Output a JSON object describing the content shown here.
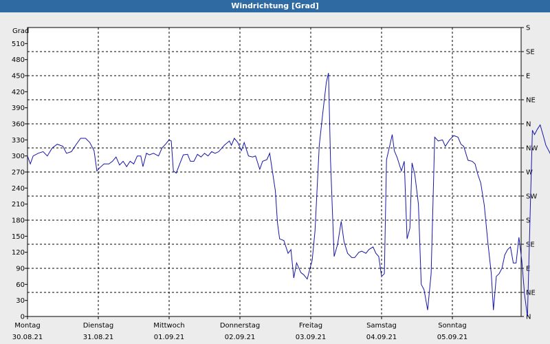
{
  "window": {
    "title": "Windrichtung [Grad]"
  },
  "colors": {
    "line": "#1515a8",
    "grid": "#000000",
    "titlebar": "#2f6aa3",
    "background": "#ececec",
    "plot": "#ffffff"
  },
  "chart_data": {
    "type": "line",
    "title": "Windrichtung [Grad]",
    "ylabel": "Grad",
    "ylim": [
      0,
      540
    ],
    "grid": true,
    "y_ticks": [
      0,
      30,
      60,
      90,
      120,
      150,
      180,
      210,
      240,
      270,
      300,
      330,
      360,
      390,
      420,
      450,
      480,
      510
    ],
    "right_axis_labels": [
      "N",
      "NE",
      "E",
      "SE",
      "S",
      "SW",
      "W",
      "NW",
      "N",
      "NE",
      "E",
      "SE",
      "S"
    ],
    "x_days": [
      {
        "day": "Montag",
        "date": "30.08.21"
      },
      {
        "day": "Dienstag",
        "date": "31.08.21"
      },
      {
        "day": "Mittwoch",
        "date": "01.09.21"
      },
      {
        "day": "Donnerstag",
        "date": "02.09.21"
      },
      {
        "day": "Freitag",
        "date": "03.09.21"
      },
      {
        "day": "Samstag",
        "date": "04.09.21"
      },
      {
        "day": "Sonntag",
        "date": "05.09.21"
      }
    ],
    "x_unit": "days since Montag 30.08.21 00:00",
    "series": [
      {
        "name": "Windrichtung",
        "points": [
          [
            0.0,
            300
          ],
          [
            0.04,
            285
          ],
          [
            0.08,
            300
          ],
          [
            0.15,
            305
          ],
          [
            0.22,
            308
          ],
          [
            0.28,
            300
          ],
          [
            0.35,
            315
          ],
          [
            0.42,
            322
          ],
          [
            0.5,
            318
          ],
          [
            0.55,
            305
          ],
          [
            0.62,
            308
          ],
          [
            0.68,
            320
          ],
          [
            0.75,
            333
          ],
          [
            0.82,
            333
          ],
          [
            0.88,
            325
          ],
          [
            0.94,
            310
          ],
          [
            0.98,
            272
          ],
          [
            1.02,
            278
          ],
          [
            1.08,
            285
          ],
          [
            1.15,
            285
          ],
          [
            1.2,
            290
          ],
          [
            1.25,
            298
          ],
          [
            1.3,
            283
          ],
          [
            1.35,
            290
          ],
          [
            1.4,
            280
          ],
          [
            1.45,
            290
          ],
          [
            1.5,
            285
          ],
          [
            1.55,
            300
          ],
          [
            1.6,
            300
          ],
          [
            1.63,
            280
          ],
          [
            1.68,
            305
          ],
          [
            1.72,
            302
          ],
          [
            1.78,
            305
          ],
          [
            1.85,
            300
          ],
          [
            1.9,
            315
          ],
          [
            1.95,
            322
          ],
          [
            2.0,
            330
          ],
          [
            2.03,
            328
          ],
          [
            2.06,
            272
          ],
          [
            2.1,
            268
          ],
          [
            2.15,
            285
          ],
          [
            2.2,
            302
          ],
          [
            2.26,
            303
          ],
          [
            2.3,
            290
          ],
          [
            2.35,
            290
          ],
          [
            2.4,
            303
          ],
          [
            2.45,
            298
          ],
          [
            2.5,
            305
          ],
          [
            2.55,
            300
          ],
          [
            2.6,
            308
          ],
          [
            2.65,
            305
          ],
          [
            2.7,
            308
          ],
          [
            2.78,
            320
          ],
          [
            2.85,
            328
          ],
          [
            2.88,
            320
          ],
          [
            2.92,
            333
          ],
          [
            2.97,
            325
          ],
          [
            3.02,
            310
          ],
          [
            3.06,
            325
          ],
          [
            3.12,
            300
          ],
          [
            3.18,
            298
          ],
          [
            3.22,
            300
          ],
          [
            3.28,
            275
          ],
          [
            3.32,
            290
          ],
          [
            3.38,
            293
          ],
          [
            3.42,
            305
          ],
          [
            3.46,
            270
          ],
          [
            3.5,
            235
          ],
          [
            3.53,
            175
          ],
          [
            3.56,
            145
          ],
          [
            3.62,
            142
          ],
          [
            3.68,
            118
          ],
          [
            3.72,
            125
          ],
          [
            3.76,
            72
          ],
          [
            3.8,
            100
          ],
          [
            3.86,
            82
          ],
          [
            3.9,
            78
          ],
          [
            3.95,
            70
          ],
          [
            3.98,
            85
          ],
          [
            4.02,
            105
          ],
          [
            4.06,
            160
          ],
          [
            4.12,
            320
          ],
          [
            4.17,
            380
          ],
          [
            4.22,
            438
          ],
          [
            4.25,
            455
          ],
          [
            4.28,
            290
          ],
          [
            4.33,
            112
          ],
          [
            4.38,
            135
          ],
          [
            4.43,
            178
          ],
          [
            4.47,
            140
          ],
          [
            4.52,
            118
          ],
          [
            4.58,
            110
          ],
          [
            4.62,
            110
          ],
          [
            4.68,
            120
          ],
          [
            4.72,
            122
          ],
          [
            4.78,
            118
          ],
          [
            4.82,
            125
          ],
          [
            4.88,
            130
          ],
          [
            4.92,
            118
          ],
          [
            4.96,
            112
          ],
          [
            5.0,
            75
          ],
          [
            5.04,
            80
          ],
          [
            5.07,
            293
          ],
          [
            5.12,
            322
          ],
          [
            5.15,
            340
          ],
          [
            5.18,
            310
          ],
          [
            5.22,
            297
          ],
          [
            5.28,
            272
          ],
          [
            5.32,
            290
          ],
          [
            5.36,
            145
          ],
          [
            5.4,
            165
          ],
          [
            5.43,
            287
          ],
          [
            5.47,
            265
          ],
          [
            5.52,
            210
          ],
          [
            5.56,
            60
          ],
          [
            5.6,
            50
          ],
          [
            5.65,
            12
          ],
          [
            5.7,
            80
          ],
          [
            5.75,
            335
          ],
          [
            5.8,
            328
          ],
          [
            5.86,
            330
          ],
          [
            5.9,
            318
          ],
          [
            5.96,
            330
          ],
          [
            6.02,
            338
          ],
          [
            6.08,
            335
          ],
          [
            6.12,
            322
          ],
          [
            6.16,
            318
          ],
          [
            6.22,
            292
          ],
          [
            6.28,
            290
          ],
          [
            6.32,
            285
          ],
          [
            6.36,
            265
          ],
          [
            6.4,
            250
          ],
          [
            6.45,
            208
          ],
          [
            6.5,
            140
          ],
          [
            6.55,
            80
          ],
          [
            6.58,
            12
          ],
          [
            6.62,
            75
          ],
          [
            6.66,
            80
          ],
          [
            6.7,
            90
          ],
          [
            6.74,
            115
          ],
          [
            6.78,
            125
          ],
          [
            6.82,
            130
          ],
          [
            6.86,
            100
          ],
          [
            6.9,
            100
          ],
          [
            6.94,
            148
          ],
          [
            6.98,
            105
          ],
          [
            7.02,
            40
          ],
          [
            7.06,
            0
          ],
          [
            7.1,
            200
          ],
          [
            7.13,
            348
          ],
          [
            7.16,
            340
          ],
          [
            7.2,
            350
          ],
          [
            7.24,
            358
          ],
          [
            7.28,
            340
          ],
          [
            7.32,
            320
          ],
          [
            7.38,
            305
          ],
          [
            7.43,
            285
          ],
          [
            7.48,
            272
          ]
        ]
      }
    ]
  }
}
